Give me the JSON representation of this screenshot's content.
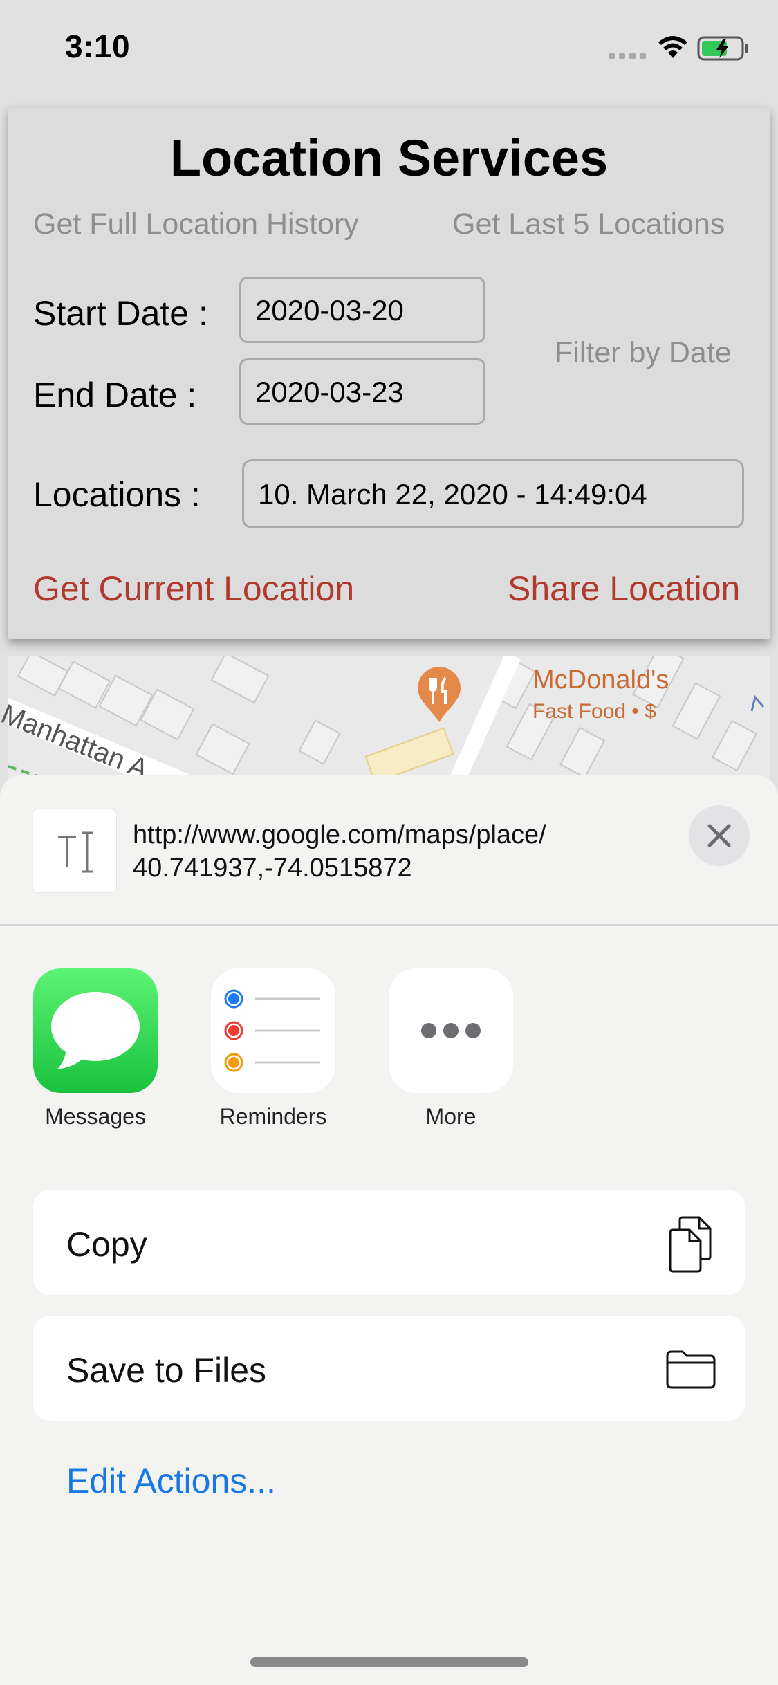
{
  "status_bar": {
    "time": "3:10"
  },
  "location_card": {
    "title": "Location Services",
    "get_full_history_label": "Get Full Location History",
    "get_last_5_label": "Get Last 5 Locations",
    "start_date_label": "Start Date :",
    "start_date_value": "2020-03-20",
    "end_date_label": "End Date :",
    "end_date_value": "2020-03-23",
    "filter_by_date_label": "Filter by Date",
    "locations_label": "Locations :",
    "locations_value": "10. March 22, 2020 - 14:49:04",
    "get_current_location_label": "Get Current Location",
    "share_location_label": "Share Location",
    "accent_color": "#b03a2e"
  },
  "map": {
    "poi_name": "McDonald's",
    "poi_category": "Fast Food • $",
    "street_label": "Manhattan A"
  },
  "share_sheet": {
    "url_line_1": "http://www.google.com/maps/place/",
    "url_line_2": "40.741937,-74.0515872",
    "apps": [
      {
        "label": "Messages",
        "icon": "messages-icon"
      },
      {
        "label": "Reminders",
        "icon": "reminders-icon"
      },
      {
        "label": "More",
        "icon": "more-icon"
      }
    ],
    "actions": [
      {
        "label": "Copy",
        "icon": "copy-icon"
      },
      {
        "label": "Save to Files",
        "icon": "folder-icon"
      }
    ],
    "edit_actions_label": "Edit Actions...",
    "link_color": "#1877e6"
  }
}
